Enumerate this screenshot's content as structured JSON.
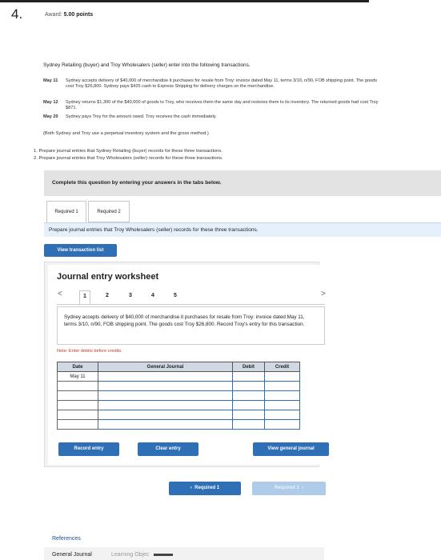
{
  "question": {
    "number": "4.",
    "award_label": "Award:",
    "award_value": "5.00 points"
  },
  "problem": {
    "intro": "Sydney Retailing (buyer) and Troy Wholesalers (seller) enter into the following transactions.",
    "transactions": [
      {
        "date": "May 11",
        "text": "Sydney accepts delivery of $40,000 of merchandise it purchases for resale from Troy: invoice dated May 11, terms 3/10, n/90, FOB shipping point. The goods cost Troy $26,800. Sydney pays $425 cash to Express Shipping for delivery charges on the merchandise."
      },
      {
        "date": "May 12",
        "text": "Sydney returns $1,300 of the $40,000 of goods to Troy, who receives them the same day and restores them to its inventory. The returned goods had cost Troy $871."
      },
      {
        "date": "May 20",
        "text": "Sydney pays Troy for the amount owed. Troy receives the cash immediately."
      }
    ],
    "both_note": "(Both Sydney and Troy use a perpetual inventory system and the gross method.)",
    "requirements": [
      "1. Prepare journal entries that Sydney Retailing (buyer) records for these three transactions.",
      "2. Prepare journal entries that Troy Wholesalers (seller) records for these three transactions."
    ]
  },
  "complete_banner": "Complete this question by entering your answers in the tabs below.",
  "tabs": [
    {
      "label": "Required 1"
    },
    {
      "label": "Required 2"
    }
  ],
  "prompt": "Prepare journal entries that Troy Wholesalers (seller) records for these three transactions.",
  "view_transaction_list": "View transaction list",
  "worksheet": {
    "title": "Journal entry worksheet",
    "pages": [
      "1",
      "2",
      "3",
      "4",
      "5"
    ],
    "prev_icon": "<",
    "next_icon": ">",
    "description": "Sydney accepts delivery of $40,000 of merchandise it purchases for resale from Troy: invoice dated May 11, terms 3/10, n/90, FOB shipping point. The goods cost Troy $26,800. Record Troy's entry for this transaction.",
    "note": "Note: Enter debits before credits.",
    "columns": {
      "date": "Date",
      "account": "General Journal",
      "debit": "Debit",
      "credit": "Credit"
    },
    "first_date": "May 11",
    "record_entry": "Record entry",
    "clear_entry": "Clear entry",
    "view_general_journal": "View general journal"
  },
  "nav": {
    "prev": "Required 1",
    "next": "Required 2"
  },
  "references": {
    "title": "References",
    "general_journal": "General Journal",
    "learning_objective": "Learning Objec"
  },
  "colors": {
    "accent": "#2f6fb6",
    "header_fill": "#cfd8e3",
    "note_red": "#c0392b"
  }
}
